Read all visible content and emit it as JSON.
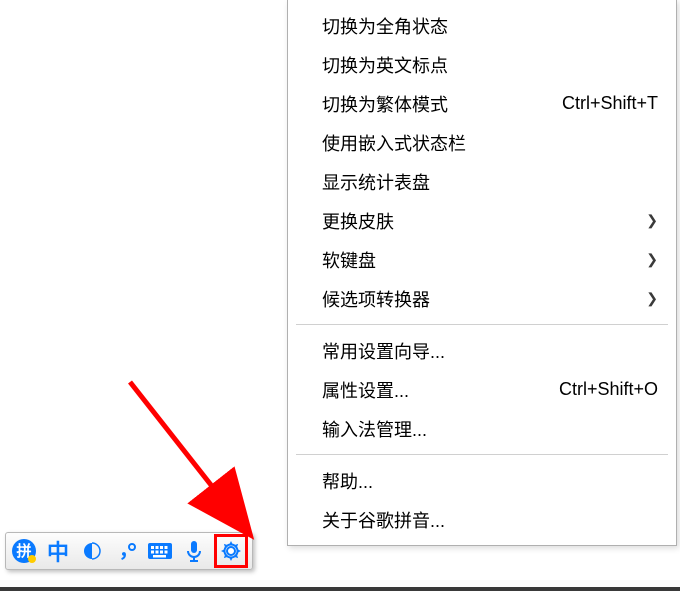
{
  "menu": {
    "items": [
      {
        "label": "切换为全角状态",
        "accel": "",
        "submenu": false
      },
      {
        "label": "切换为英文标点",
        "accel": "",
        "submenu": false
      },
      {
        "label": "切换为繁体模式",
        "accel": "Ctrl+Shift+T",
        "submenu": false
      },
      {
        "label": "使用嵌入式状态栏",
        "accel": "",
        "submenu": false
      },
      {
        "label": "显示统计表盘",
        "accel": "",
        "submenu": false
      },
      {
        "label": "更换皮肤",
        "accel": "",
        "submenu": true
      },
      {
        "label": "软键盘",
        "accel": "",
        "submenu": true
      },
      {
        "label": "候选项转换器",
        "accel": "",
        "submenu": true
      }
    ],
    "items2": [
      {
        "label": "常用设置向导...",
        "accel": "",
        "submenu": false
      },
      {
        "label": "属性设置...",
        "accel": "Ctrl+Shift+O",
        "submenu": false
      },
      {
        "label": "输入法管理...",
        "accel": "",
        "submenu": false
      }
    ],
    "items3": [
      {
        "label": "帮助...",
        "accel": "",
        "submenu": false
      },
      {
        "label": "关于谷歌拼音...",
        "accel": "",
        "submenu": false
      }
    ]
  },
  "ime": {
    "buttons": [
      {
        "name": "pinyin-logo-icon"
      },
      {
        "name": "chinese-mode-icon",
        "glyph": "中"
      },
      {
        "name": "halfwidth-icon"
      },
      {
        "name": "punctuation-icon"
      },
      {
        "name": "soft-keyboard-icon"
      },
      {
        "name": "voice-input-icon"
      },
      {
        "name": "settings-gear-icon"
      }
    ]
  }
}
